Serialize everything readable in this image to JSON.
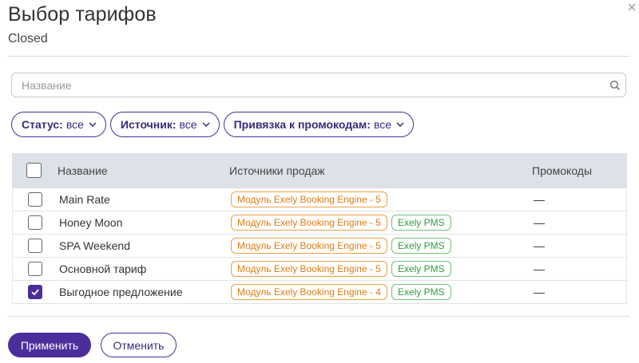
{
  "dialog": {
    "title": "Выбор тарифов",
    "subtitle": "Closed"
  },
  "search": {
    "placeholder": "Название",
    "value": ""
  },
  "filters": [
    {
      "name": "Статус:",
      "value": "все"
    },
    {
      "name": "Источник:",
      "value": "все"
    },
    {
      "name": "Привязка к промокодам:",
      "value": "все"
    }
  ],
  "table": {
    "headers": {
      "name": "Название",
      "sources": "Источники продаж",
      "promo": "Промокоды"
    },
    "rows": [
      {
        "name": "Main Rate",
        "sources": [
          "Модуль Exely Booking Engine - 5"
        ],
        "promo": "—",
        "checked": false
      },
      {
        "name": "Honey Moon",
        "sources": [
          "Модуль Exely Booking Engine - 5",
          "Exely PMS"
        ],
        "promo": "—",
        "checked": false
      },
      {
        "name": "SPA Weekend",
        "sources": [
          "Модуль Exely Booking Engine - 5",
          "Exely PMS"
        ],
        "promo": "—",
        "checked": false
      },
      {
        "name": "Основной тариф",
        "sources": [
          "Модуль Exely Booking Engine - 5",
          "Exely PMS"
        ],
        "promo": "—",
        "checked": false
      },
      {
        "name": "Выгодное предложение",
        "sources": [
          "Модуль Exely Booking Engine - 4",
          "Exely PMS"
        ],
        "promo": "—",
        "checked": true
      }
    ]
  },
  "buttons": {
    "apply": "Применить",
    "cancel": "Отменить"
  },
  "icons": {
    "close": "close-icon",
    "search": "search-icon",
    "chevron": "chevron-down-icon",
    "check": "check-icon"
  },
  "colors": {
    "accent": "#4b2e9b",
    "booking_badge": "#e07c12",
    "pms_badge": "#2e9c3e",
    "header_bg": "#dde1e8"
  }
}
